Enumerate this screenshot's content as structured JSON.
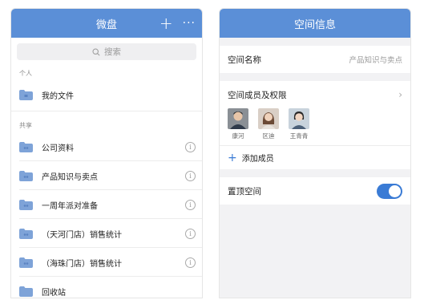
{
  "left": {
    "title": "微盘",
    "search_placeholder": "搜索",
    "personal_label": "个人",
    "personal_items": [
      {
        "label": "我的文件"
      }
    ],
    "shared_label": "共享",
    "shared_items": [
      {
        "label": "公司资料"
      },
      {
        "label": "产品知识与卖点"
      },
      {
        "label": "一周年派对准备"
      },
      {
        "label": "（天河门店）销售统计"
      },
      {
        "label": "（海珠门店）销售统计"
      }
    ],
    "recycle_label": "回收站"
  },
  "right": {
    "title": "空间信息",
    "space_name_label": "空间名称",
    "space_name_value": "产品知识与卖点",
    "members_label": "空间成员及权限",
    "members": [
      {
        "name": "康河"
      },
      {
        "name": "区迪"
      },
      {
        "name": "王青青"
      }
    ],
    "add_member_label": "添加成员",
    "pin_label": "置顶空间",
    "pin_enabled": true
  },
  "colors": {
    "header": "#5b8fd7",
    "accent": "#3a7bd5",
    "folder": "#7ea3d8"
  }
}
